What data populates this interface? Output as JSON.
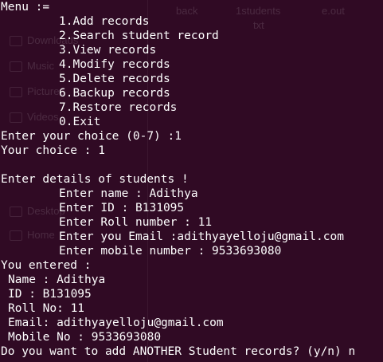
{
  "background": {
    "items": [
      "back",
      "1students",
      "e.out",
      "txt"
    ],
    "sidebar": [
      "Downloads",
      "Music",
      "Pictures",
      "Videos",
      "Desktop",
      "Home"
    ]
  },
  "terminal": {
    "menu_header": "Menu :=",
    "menu_items": [
      "1.Add records",
      "2.Search student record",
      "3.View records",
      "4.Modify records",
      "5.Delete records",
      "6.Backup records",
      "7.Restore records",
      "0.Exit"
    ],
    "prompt_choice": "Enter your choice (0-7) :1",
    "your_choice": "Your choice : 1",
    "details_header": "Enter details of students !",
    "inputs": [
      "Enter name : Adithya",
      "Enter ID : B131095",
      "Enter Roll number : 11",
      "Enter you Email :adithyayelloju@gmail.com",
      "Enter mobile number : 9533693080"
    ],
    "entered_header": "You entered :",
    "entered": [
      "Name : Adithya",
      "ID : B131095",
      "Roll No: 11",
      "Email: adithyayelloju@gmail.com",
      "Mobile No : 9533693080"
    ],
    "final_prompt": "Do you want to add ANOTHER Student records? (y/n) n"
  }
}
